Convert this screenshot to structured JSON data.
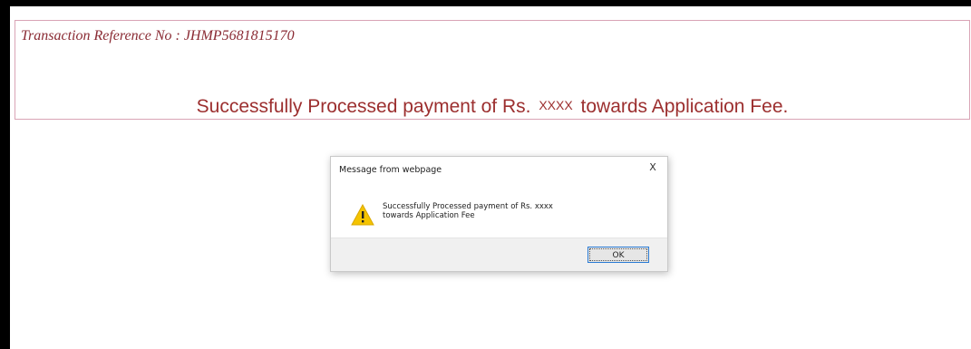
{
  "banner": {
    "transaction_ref": "Transaction Reference No : JHMP5681815170",
    "success_prefix": "Successfully Processed payment of Rs.",
    "success_amount": "XXXX",
    "success_suffix": "towards Application Fee."
  },
  "dialog": {
    "title": "Message from webpage",
    "close": "X",
    "icon": "warning-icon",
    "message_line1": "Successfully Processed payment of Rs. xxxx",
    "message_line2": "towards Application Fee",
    "ok_label": "OK"
  },
  "colors": {
    "text_accent": "#9c2f2f",
    "banner_border": "#d9a4b5",
    "button_focus": "#2a7bd4",
    "warning": "#f5c400"
  }
}
